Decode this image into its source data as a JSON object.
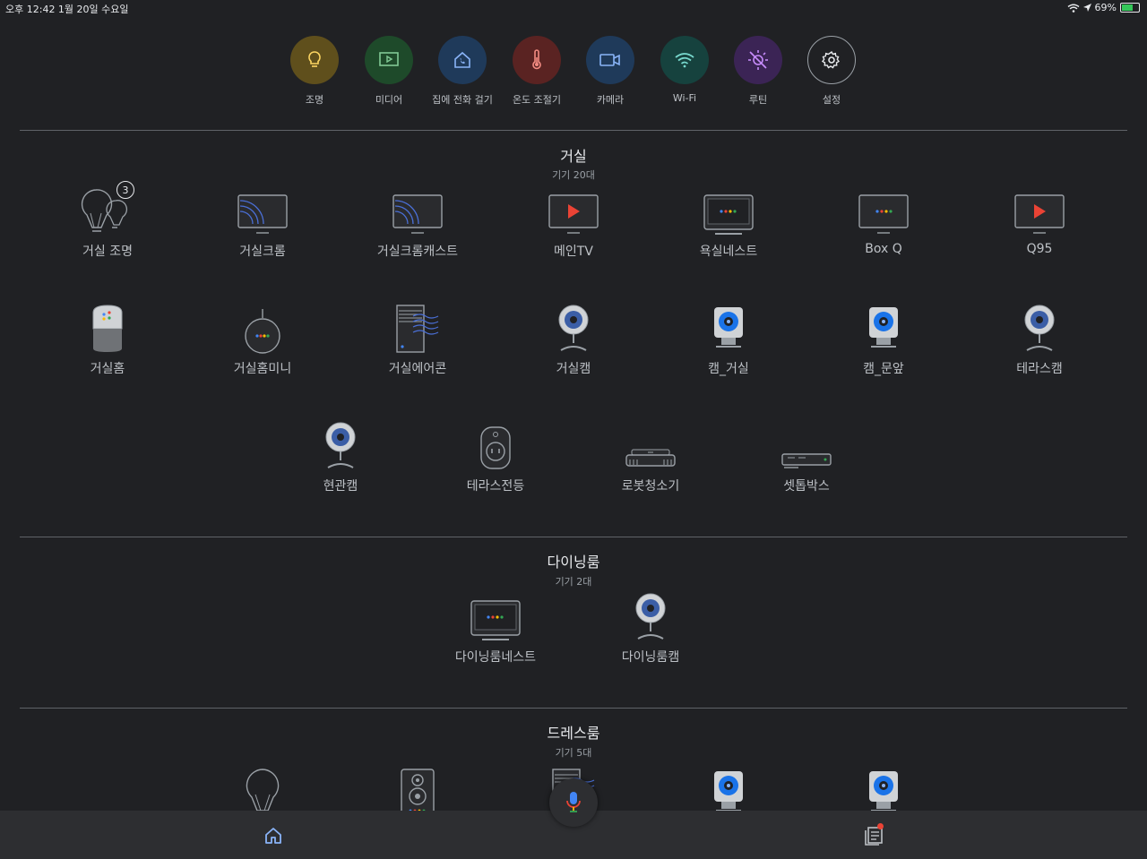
{
  "status_bar": {
    "time_date": "오후 12:42   1월 20일 수요일",
    "battery": "69%",
    "battery_level": 0.69
  },
  "shortcuts": [
    {
      "label": "조명",
      "icon": "lightbulb-icon",
      "bg": "#5f4f1c",
      "color": "#fdd663"
    },
    {
      "label": "미디어",
      "icon": "media-play-icon",
      "bg": "#1e4a2a",
      "color": "#81c995"
    },
    {
      "label": "집에 전화 걸기",
      "icon": "home-call-icon",
      "bg": "#1f3a5a",
      "color": "#8ab4f8"
    },
    {
      "label": "온도 조절기",
      "icon": "thermometer-icon",
      "bg": "#5a2322",
      "color": "#f28b82"
    },
    {
      "label": "카메라",
      "icon": "video-camera-icon",
      "bg": "#1f3a5a",
      "color": "#8ab4f8"
    },
    {
      "label": "Wi-Fi",
      "icon": "wifi-icon",
      "bg": "#16423e",
      "color": "#78d9ce"
    },
    {
      "label": "루틴",
      "icon": "routine-sun-icon",
      "bg": "#3b2455",
      "color": "#c58af9"
    },
    {
      "label": "설정",
      "icon": "gear-icon",
      "bg": "#202124",
      "color": "#e8eaed"
    }
  ],
  "rooms": [
    {
      "name": "거실",
      "count": "기기 20대",
      "devices": [
        {
          "name": "거실 조명",
          "icon": "light-group-icon",
          "badge": "3"
        },
        {
          "name": "거실크롬",
          "icon": "chromecast-tv-icon"
        },
        {
          "name": "거실크롬캐스트",
          "icon": "chromecast-tv-icon"
        },
        {
          "name": "메인TV",
          "icon": "tv-youtube-icon"
        },
        {
          "name": "욕실네스트",
          "icon": "nest-hub-icon"
        },
        {
          "name": "Box Q",
          "icon": "tv-assistant-icon"
        },
        {
          "name": "Q95",
          "icon": "tv-youtube-icon"
        },
        {
          "name": "거실홈",
          "icon": "google-home-icon"
        },
        {
          "name": "거실홈미니",
          "icon": "home-mini-icon"
        },
        {
          "name": "거실에어콘",
          "icon": "air-conditioner-icon"
        },
        {
          "name": "거실캠",
          "icon": "round-camera-icon"
        },
        {
          "name": "캠_거실",
          "icon": "square-camera-icon"
        },
        {
          "name": "캠_문앞",
          "icon": "square-camera-icon"
        },
        {
          "name": "테라스캠",
          "icon": "round-camera-icon"
        },
        {
          "name": "현관캠",
          "icon": "round-camera-icon"
        },
        {
          "name": "테라스전등",
          "icon": "smart-plug-icon"
        },
        {
          "name": "로봇청소기",
          "icon": "robot-vacuum-icon"
        },
        {
          "name": "셋톱박스",
          "icon": "settop-box-icon"
        }
      ]
    },
    {
      "name": "다이닝룸",
      "count": "기기 2대",
      "devices": [
        {
          "name": "다이닝룸네스트",
          "icon": "nest-hub-icon"
        },
        {
          "name": "다이닝룸캠",
          "icon": "round-camera-icon"
        }
      ]
    },
    {
      "name": "드레스룸",
      "count": "기기 5대",
      "devices": [
        {
          "name": "",
          "icon": "light-icon"
        },
        {
          "name": "",
          "icon": "speaker-icon"
        },
        {
          "name": "",
          "icon": "air-conditioner-icon"
        },
        {
          "name": "",
          "icon": "square-camera-icon"
        },
        {
          "name": "",
          "icon": "square-camera-icon"
        }
      ]
    }
  ],
  "bottom_nav": [
    {
      "icon": "home-icon",
      "active": true
    },
    {
      "icon": "mic-icon"
    },
    {
      "icon": "feed-icon",
      "notification": true
    }
  ]
}
